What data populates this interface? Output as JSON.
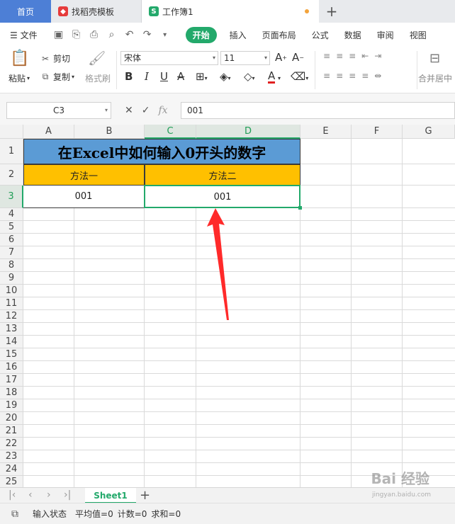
{
  "tabs": {
    "home": "首页",
    "template": "找稻壳模板",
    "workbook": "工作簿1"
  },
  "menu": {
    "file": "文件",
    "items": [
      "开始",
      "插入",
      "页面布局",
      "公式",
      "数据",
      "审阅",
      "视图"
    ],
    "active": "开始"
  },
  "ribbon": {
    "paste": "粘贴",
    "cut": "剪切",
    "copy": "复制",
    "format_painter": "格式刷",
    "font_name": "宋体",
    "font_size": "11",
    "merge": "合并居中"
  },
  "formula_bar": {
    "name_box": "C3",
    "fx": "fx",
    "value": "001"
  },
  "columns": [
    "A",
    "B",
    "C",
    "D",
    "E",
    "F",
    "G"
  ],
  "rows": [
    "1",
    "2",
    "3",
    "4",
    "5",
    "6",
    "7",
    "8",
    "9",
    "10",
    "11",
    "12",
    "13",
    "14",
    "15",
    "16",
    "17",
    "18",
    "19",
    "20",
    "21",
    "22",
    "23",
    "24",
    "25"
  ],
  "cells": {
    "title": "在Excel中如何输入0开头的数字",
    "method1": "方法一",
    "method2": "方法二",
    "a3": "001",
    "c3": "001"
  },
  "sheets": [
    "Sheet1"
  ],
  "status": {
    "mode": "输入状态",
    "average": "平均值=0",
    "count": "计数=0",
    "sum": "求和=0"
  },
  "watermark": {
    "main": "Bai 经验",
    "url": "jingyan.baidu.com"
  },
  "colors": {
    "accent": "#23a96b",
    "title_fill": "#5b9bd5",
    "header_fill": "#ffc000",
    "arrow": "#ff2a2a"
  }
}
